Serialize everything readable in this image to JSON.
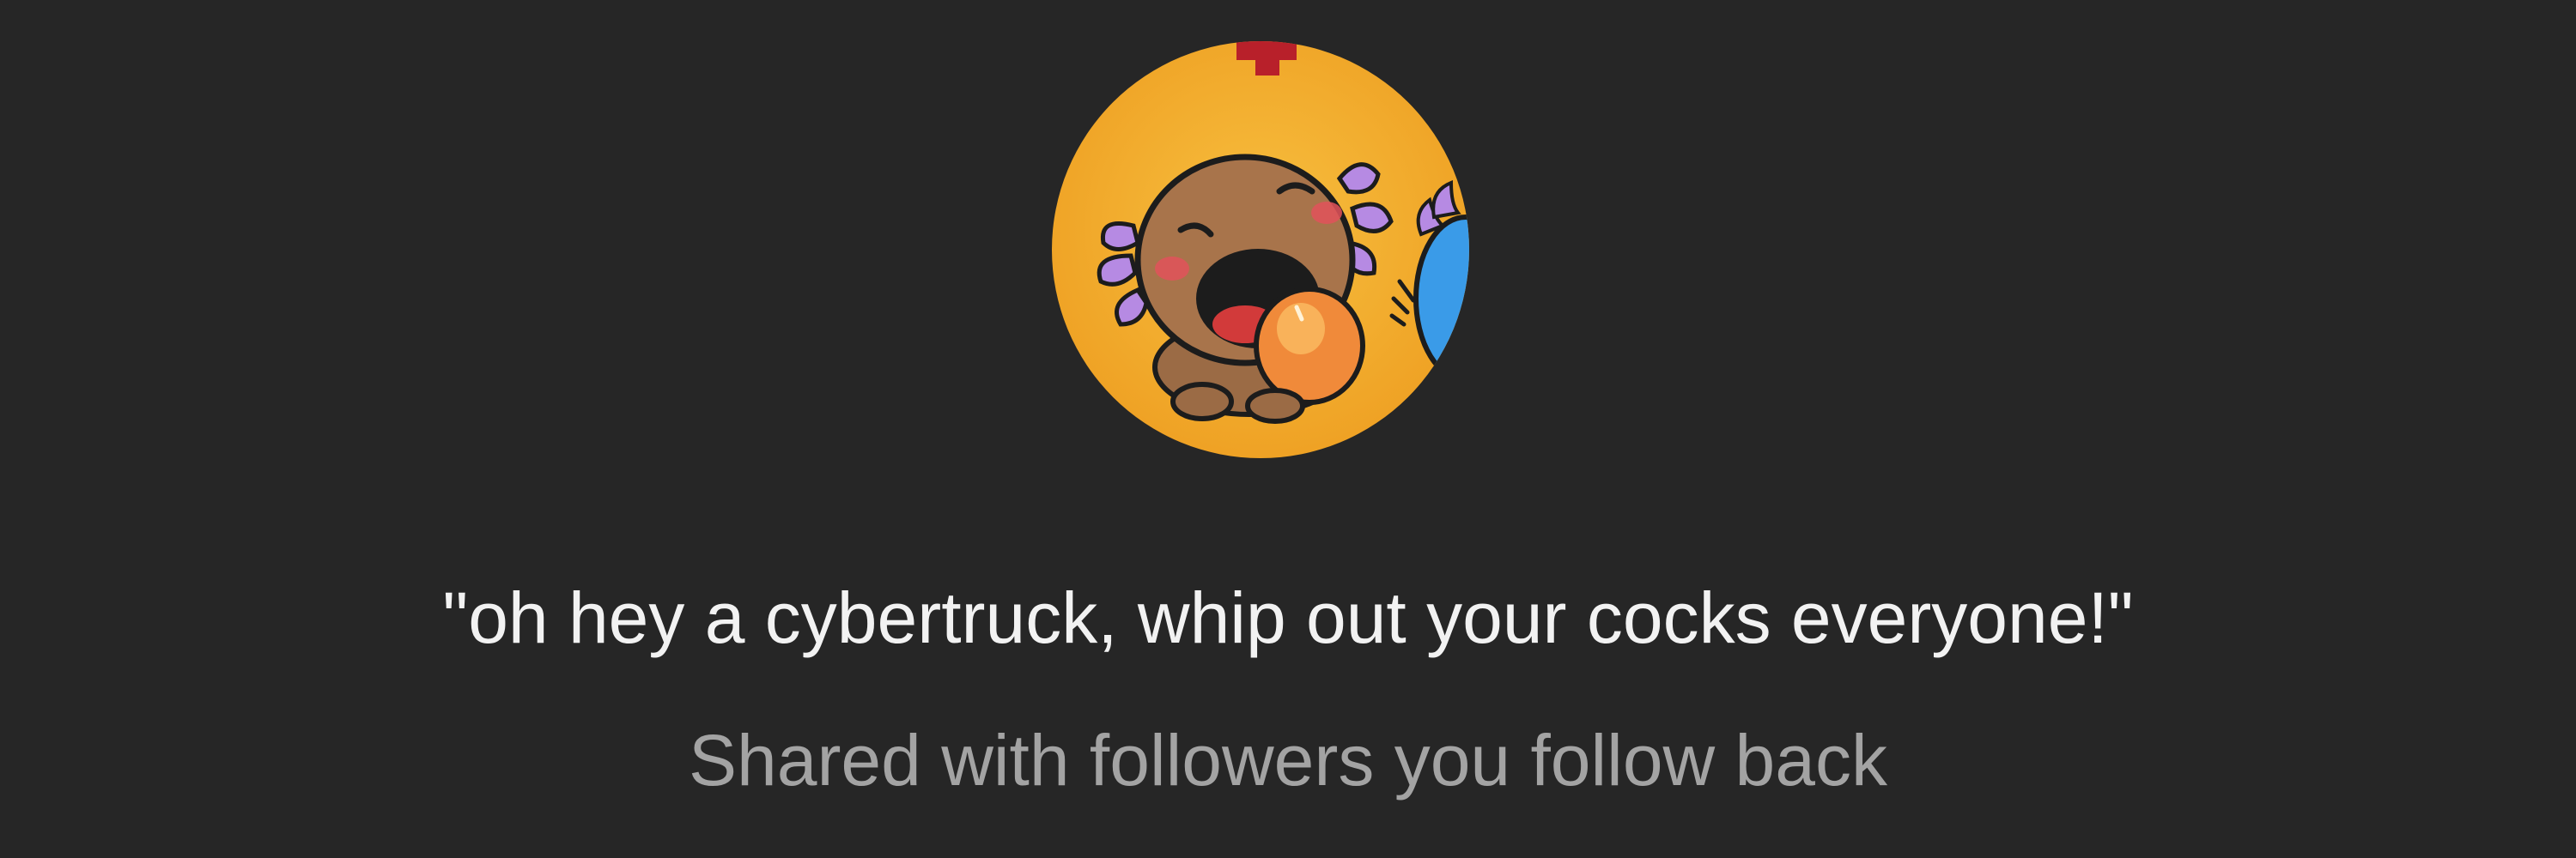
{
  "profile": {
    "avatar_icon": "cartoon-axolotl-avatar-icon",
    "avatar_background": "#f4b12f"
  },
  "note": {
    "text": "\"oh hey a cybertruck, whip out your cocks everyone!\""
  },
  "visibility": {
    "label": "Shared with followers you follow back"
  },
  "colors": {
    "background": "#262626",
    "note_text": "#f2f2f2",
    "secondary_text": "#a3a3a3"
  }
}
